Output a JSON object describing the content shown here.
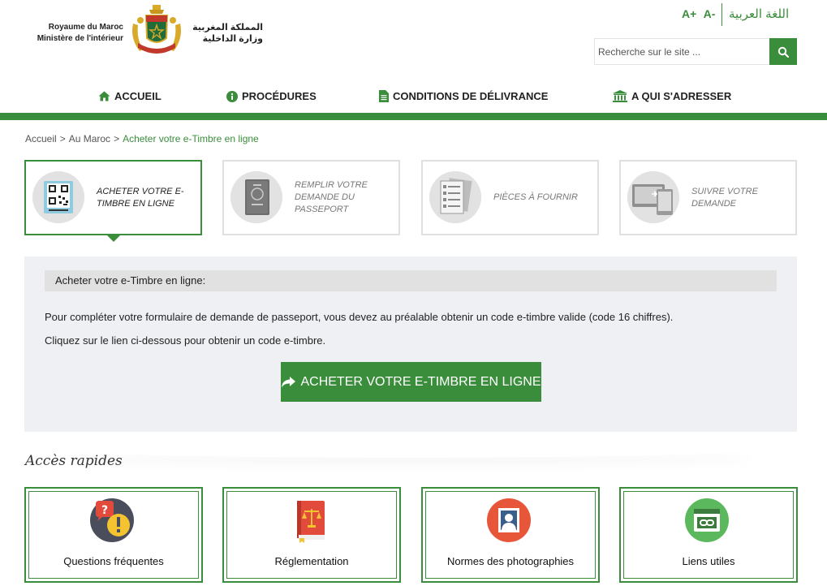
{
  "header": {
    "ministry_fr_line1": "Royaume du Maroc",
    "ministry_fr_line2": "Ministère de l'intérieur",
    "ministry_ar_line1": "المملكة المغربية",
    "ministry_ar_line2": "وزارة الداخلية",
    "font_increase": "A+",
    "font_decrease": "A-",
    "lang_switch": "اللغة العربية",
    "search_placeholder": "Recherche sur le site ..."
  },
  "nav": [
    {
      "label": "ACCUEIL",
      "icon": "home-icon"
    },
    {
      "label": "PROCÉDURES",
      "icon": "info-icon"
    },
    {
      "label": "CONDITIONS DE DÉLIVRANCE",
      "icon": "document-icon"
    },
    {
      "label": "A QUI S'ADRESSER",
      "icon": "bank-icon"
    }
  ],
  "breadcrumb": {
    "items": [
      "Accueil",
      "Au Maroc"
    ],
    "separator": ">",
    "current": "Acheter votre e-Timbre en ligne"
  },
  "steps": [
    {
      "label": "ACHETER VOTRE E-TIMBRE EN LIGNE",
      "icon": "qr-stamp-icon",
      "active": true
    },
    {
      "label": "REMPLIR VOTRE DEMANDE DU PASSEPORT",
      "icon": "passport-icon",
      "active": false
    },
    {
      "label": "PIÈCES À FOURNIR",
      "icon": "documents-icon",
      "active": false
    },
    {
      "label": "SUIVRE VOTRE DEMANDE",
      "icon": "devices-icon",
      "active": false
    }
  ],
  "panel": {
    "title": "Acheter votre e-Timbre en ligne:",
    "paragraph1": "Pour compléter votre formulaire de demande de passeport, vous devez au préalable obtenir un code e-timbre valide (code 16 chiffres).",
    "paragraph2": "Cliquez sur le lien ci-dessous pour obtenir un code e-timbre.",
    "cta_label": "ACHETER VOTRE E-TIMBRE EN LIGNE",
    "cta_icon": "share-arrow-icon"
  },
  "quick_access": {
    "title": "Accès rapides",
    "items": [
      {
        "label": "Questions fréquentes",
        "icon": "faq-icon"
      },
      {
        "label": "Réglementation",
        "icon": "law-book-icon"
      },
      {
        "label": "Normes des photographies",
        "icon": "photo-portrait-icon"
      },
      {
        "label": "Liens utiles",
        "icon": "link-icon"
      }
    ]
  },
  "colors": {
    "accent": "#3a8d3b",
    "panel_bg": "#eef0f4",
    "panel_title_bg": "#e1e1e1"
  }
}
